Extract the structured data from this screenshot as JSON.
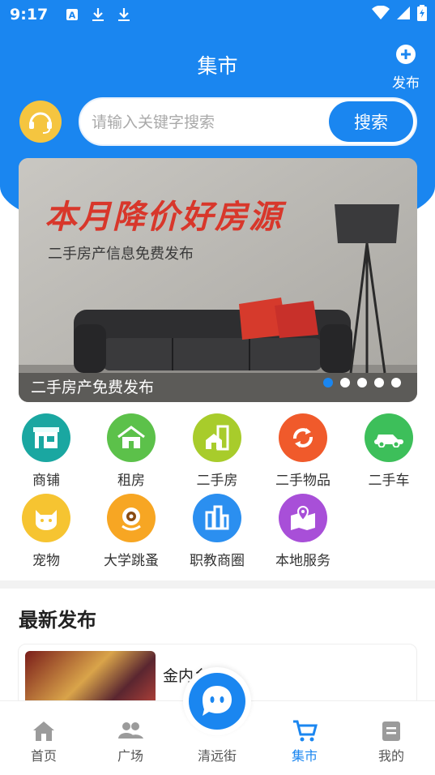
{
  "status_bar": {
    "time": "9:17"
  },
  "header": {
    "title": "集市",
    "publish_label": "发布"
  },
  "search": {
    "placeholder": "请输入关键字搜索",
    "button_label": "搜索"
  },
  "banner": {
    "headline": "本月降价好房源",
    "subheadline": "二手房产信息免费发布",
    "caption": "二手房产免费发布",
    "slide_count": 5,
    "active_slide": 1
  },
  "categories": [
    {
      "label": "商铺",
      "icon": "shop-icon",
      "color": "#1aa7a1"
    },
    {
      "label": "租房",
      "icon": "rent-house-icon",
      "color": "#5cc14a"
    },
    {
      "label": "二手房",
      "icon": "secondhand-house-icon",
      "color": "#a8cc2b"
    },
    {
      "label": "二手物品",
      "icon": "recycle-icon",
      "color": "#f05a2b"
    },
    {
      "label": "二手车",
      "icon": "car-icon",
      "color": "#3dbf5a"
    },
    {
      "label": "宠物",
      "icon": "cat-icon",
      "color": "#f6c431"
    },
    {
      "label": "大学跳蚤",
      "icon": "eye-monster-icon",
      "color": "#f7a623"
    },
    {
      "label": "职教商圈",
      "icon": "buildings-icon",
      "color": "#2b8ff0"
    },
    {
      "label": "本地服务",
      "icon": "map-pin-icon",
      "color": "#a84fd8"
    }
  ],
  "latest": {
    "title": "最新发布",
    "posts": [
      {
        "title": "金内乡"
      }
    ]
  },
  "tabbar": {
    "tabs": [
      {
        "label": "首页",
        "icon": "home-icon"
      },
      {
        "label": "广场",
        "icon": "people-icon"
      },
      {
        "label": "清远街",
        "icon": "chat-bubble-icon"
      },
      {
        "label": "集市",
        "icon": "cart-icon",
        "active": true
      },
      {
        "label": "我的",
        "icon": "profile-icon"
      }
    ]
  },
  "colors": {
    "brand_blue": "#1a86f0",
    "banner_red": "#d8372b"
  }
}
